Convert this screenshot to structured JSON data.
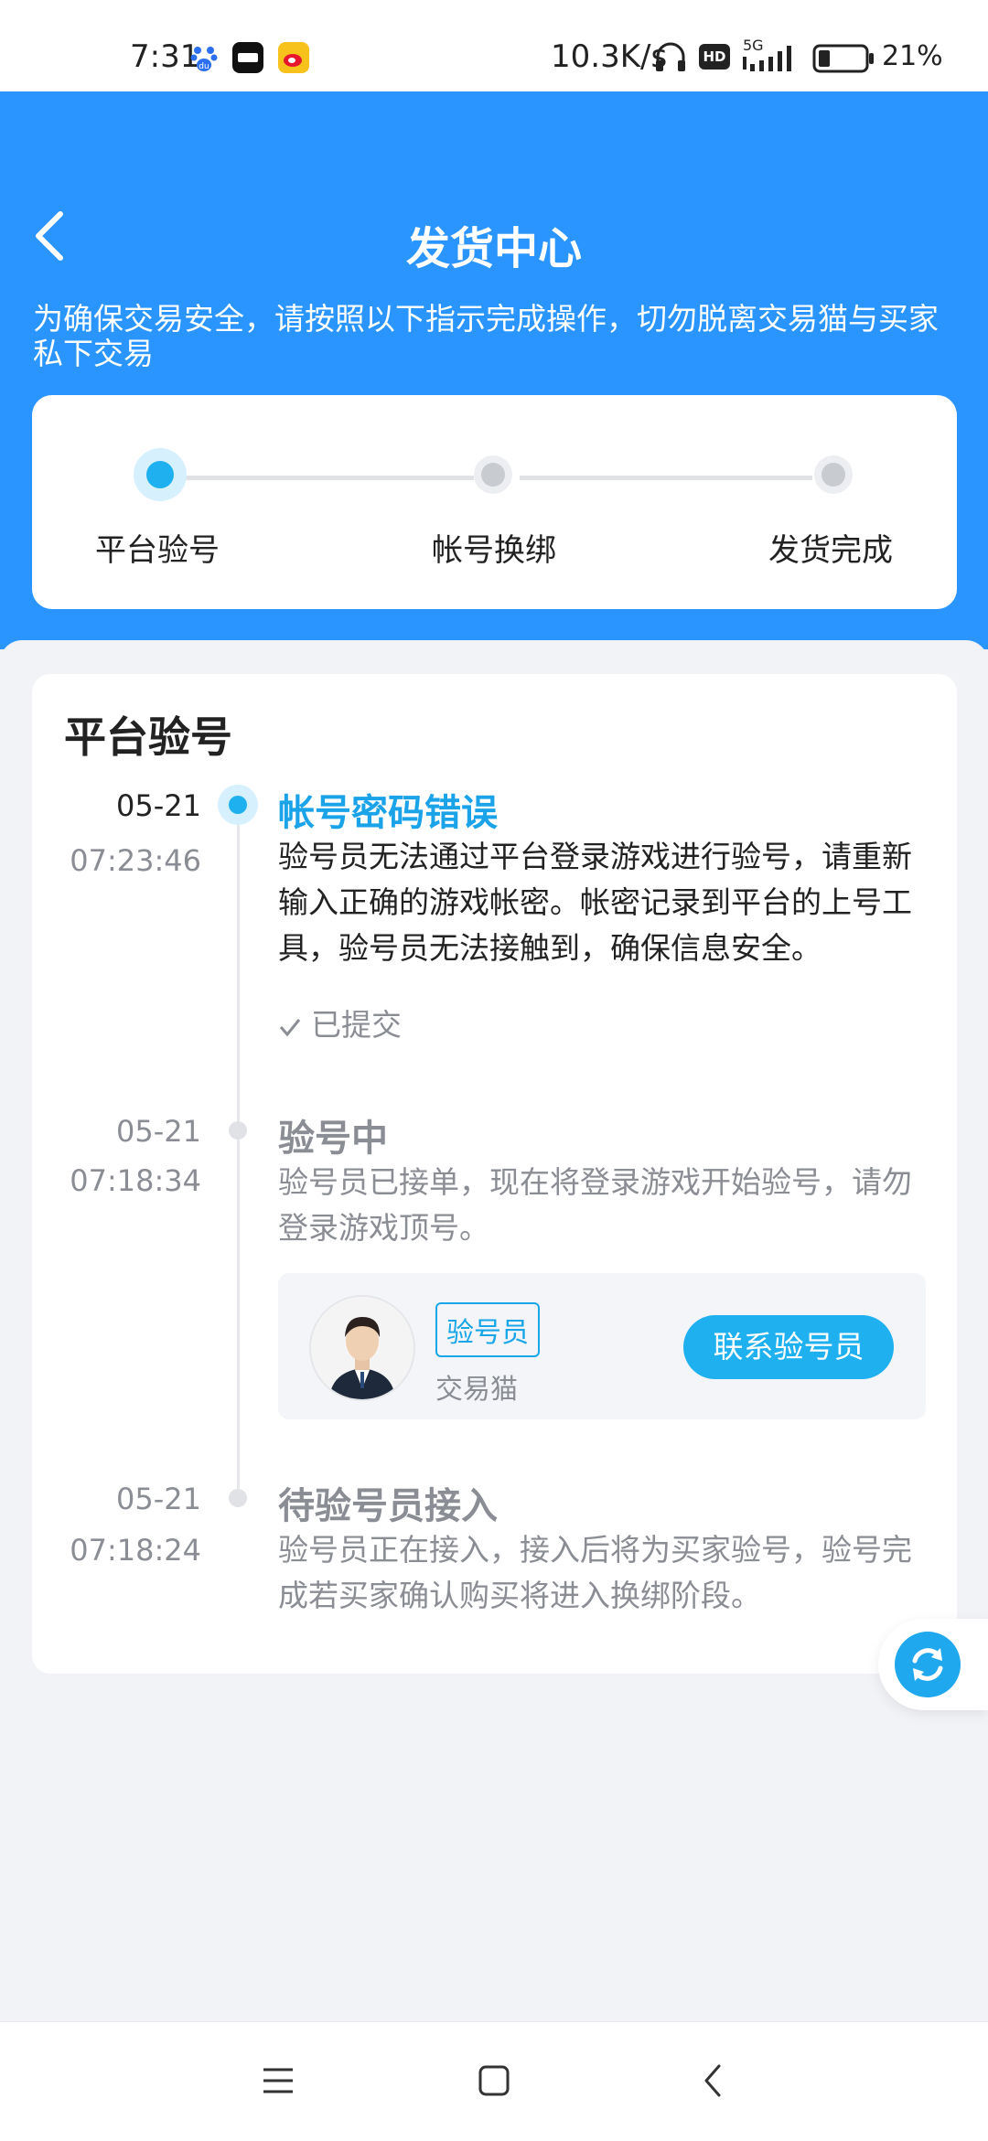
{
  "status_bar": {
    "time": "7:31",
    "network_speed": "10.3K/s",
    "network_type": "5G",
    "battery": "21%",
    "icons": [
      "baidu-icon",
      "youdao-icon",
      "weibo-icon",
      "headphone-icon",
      "hd-icon",
      "signal-icon",
      "battery-icon"
    ]
  },
  "header": {
    "title": "发货中心",
    "notice": "为确保交易安全，请按照以下指示完成操作，切勿脱离交易猫与买家私下交易",
    "background_color": "#2b95ff"
  },
  "progress": {
    "steps": [
      {
        "label": "平台验号",
        "state": "active"
      },
      {
        "label": "帐号换绑",
        "state": "pending"
      },
      {
        "label": "发货完成",
        "state": "pending"
      }
    ],
    "active_color": "#1fb0f0"
  },
  "section": {
    "title": "平台验号"
  },
  "timeline": [
    {
      "date": "05-21",
      "time": "07:23:46",
      "title": "帐号密码错误",
      "description": "验号员无法通过平台登录游戏进行验号，请重新输入正确的游戏帐密。帐密记录到平台的上号工具，验号员无法接触到，确保信息安全。",
      "status": "已提交",
      "current": true
    },
    {
      "date": "05-21",
      "time": "07:18:34",
      "title": "验号中",
      "description": "验号员已接单，现在将登录游戏开始验号，请勿登录游戏顶号。",
      "current": false
    },
    {
      "date": "05-21",
      "time": "07:18:24",
      "title": "待验号员接入",
      "description": "验号员正在接入，接入后将为买家验号，验号完成若买家确认购买将进入换绑阶段。",
      "current": false
    }
  ],
  "agent": {
    "role": "验号员",
    "org": "交易猫",
    "contact_label": "联系验号员"
  },
  "nav": {
    "icons": [
      "menu-icon",
      "home-icon",
      "back-icon"
    ]
  }
}
